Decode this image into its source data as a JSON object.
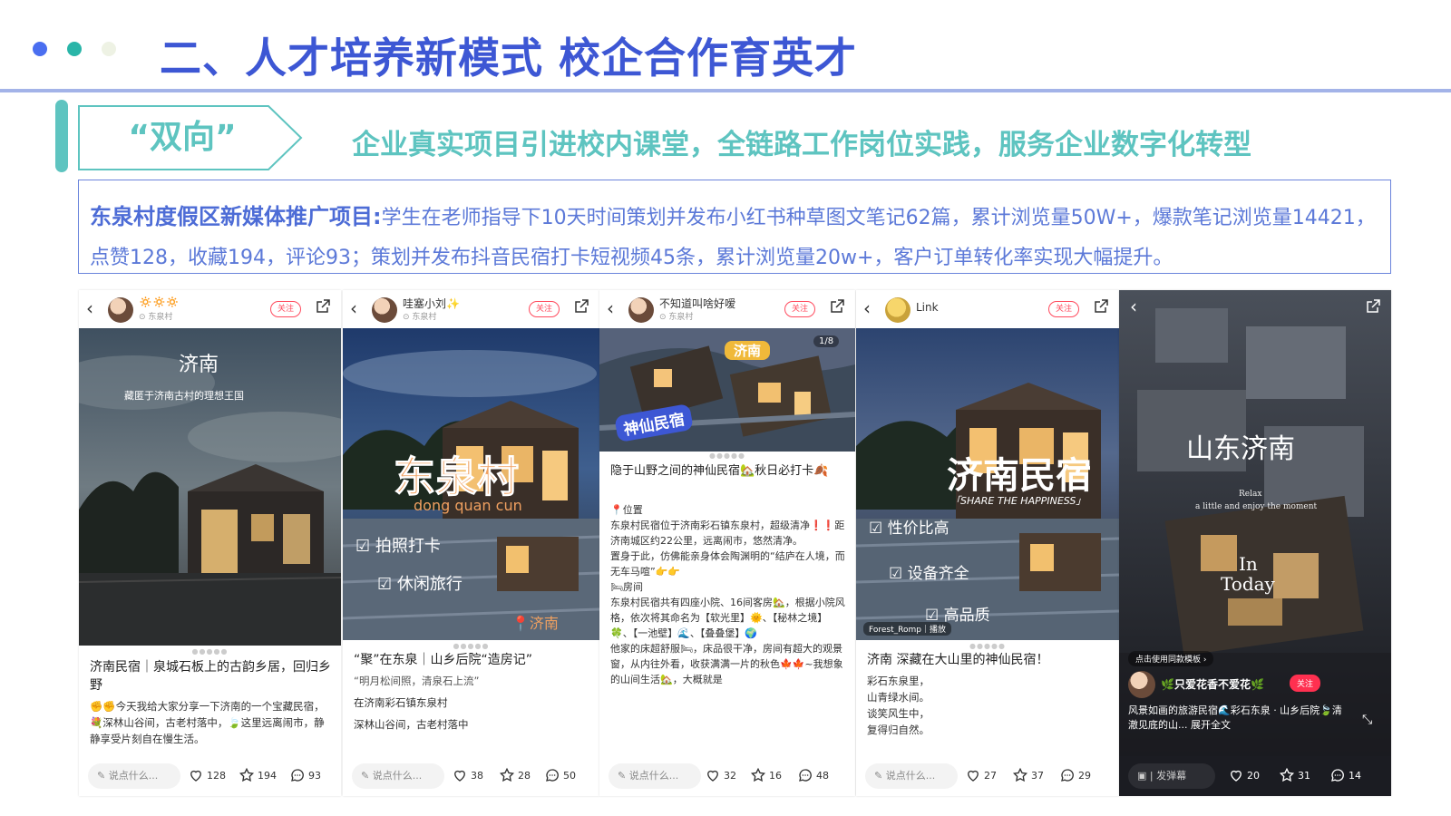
{
  "header": {
    "title": "二、人才培养新模式 校企合作育英才",
    "dot_colors": [
      "#4a6ef0",
      "#29b5a8",
      "#eef2e4"
    ]
  },
  "banner": {
    "tag": "“双向”",
    "slogan": "企业真实项目引进校内课堂，全链路工作岗位实践，服务企业数字化转型"
  },
  "description": {
    "lead": "东泉村度假区新媒体推广项目:",
    "text": "学生在老师指导下10天时间策划并发布小红书种草图文笔记62篇，累计浏览量50W+，爆款笔记浏览量14421，点赞128，收藏194，评论93；策划并发布抖音民宿打卡短视频45条，累计浏览量20w+，客户订单转化率实现大幅提升。"
  },
  "colors": {
    "accent_blue": "#3d57d4",
    "accent_teal": "#5ec4c0",
    "follow_red": "#ff4a5d"
  },
  "posts": [
    {
      "user": "🔅🔅🔅",
      "location": "东泉村",
      "follow": "关注",
      "overlay": [
        "济南",
        "藏匿于济南古村的理想王国"
      ],
      "title": "济南民宿｜泉城石板上的古韵乡居，回归乡野",
      "body": "✊✊今天我给大家分享一下济南的一个宝藏民宿，💐深林山谷间，古老村落中，🍃这里远离闹市，静静享受片刻自在慢生活。",
      "comment_placeholder": "说点什么...",
      "likes": "128",
      "stars": "194",
      "comments": "93"
    },
    {
      "user": "哇塞小刘✨",
      "location": "东泉村",
      "follow": "关注",
      "overlay": [
        "东泉村",
        "dong quan cun",
        "☑ 拍照打卡",
        "☑ 休闲旅行",
        "📍济南"
      ],
      "title": "“聚”在东泉｜山乡后院“造房记”",
      "subtitle": "“明月松间照，清泉石上流”",
      "body1": "在济南彩石镇东泉村",
      "body2": "深林山谷间，古老村落中",
      "comment_placeholder": "说点什么...",
      "likes": "38",
      "stars": "28",
      "comments": "50"
    },
    {
      "user": "不知道叫啥好嗳",
      "location": "东泉村",
      "follow": "关注",
      "overlay": [
        "济南",
        "神仙民宿",
        "1/8"
      ],
      "title": "隐于山野之间的神仙民宿🏡秋日必打卡🍂",
      "body": "📍位置\n东泉村民宿位于济南彩石镇东泉村，超级清净❗❗距济南城区约22公里，远离闹市，悠然清净。\n置身于此，仿佛能亲身体会陶渊明的“结庐在人境，而无车马喧”👉👉\n🛏房间\n东泉村民宿共有四座小院、16间客房🏡，根据小院风格，依次将其命名为【软光里】🌞、【秘林之境】🍀、【一池壁】🌊、【叠叠堡】🌍\n他家的床超舒服🛏，床品很干净，房间有超大的观景窗，从内往外看，收获满满一片的秋色🍁🍁~我想象的山间生活🏡，大概就是",
      "comment_placeholder": "说点什么...",
      "likes": "32",
      "stars": "16",
      "comments": "48"
    },
    {
      "user": "Link",
      "location": "",
      "follow": "关注",
      "overlay": [
        "济南民宿",
        "「SHARE THE HAPPINESS」",
        "☑ 性价比高",
        "☑ 设备齐全",
        "☑ 高品质",
        "Forest_Romp｜播放"
      ],
      "title": "济南 深藏在大山里的神仙民宿！",
      "body": "彩石东泉里，\n山青绿水间。\n谈笑风生中，\n复得归自然。",
      "comment_placeholder": "说点什么...",
      "likes": "27",
      "stars": "37",
      "comments": "29"
    },
    {
      "user": "🌿只爱花香不爱花🌿",
      "follow": "关注",
      "overlay": [
        "山东济南",
        "Relax",
        "a little and enjoy the moment",
        "In",
        "Today"
      ],
      "template_hint": "点击使用同款模板 ›",
      "caption": "风景如画的旅游民宿🌊彩石东泉 · 山乡后院🍃清澈见底的山... 展开全文",
      "comment_placeholder": "发弹幕",
      "likes": "20",
      "stars": "31",
      "comments": "14"
    }
  ]
}
